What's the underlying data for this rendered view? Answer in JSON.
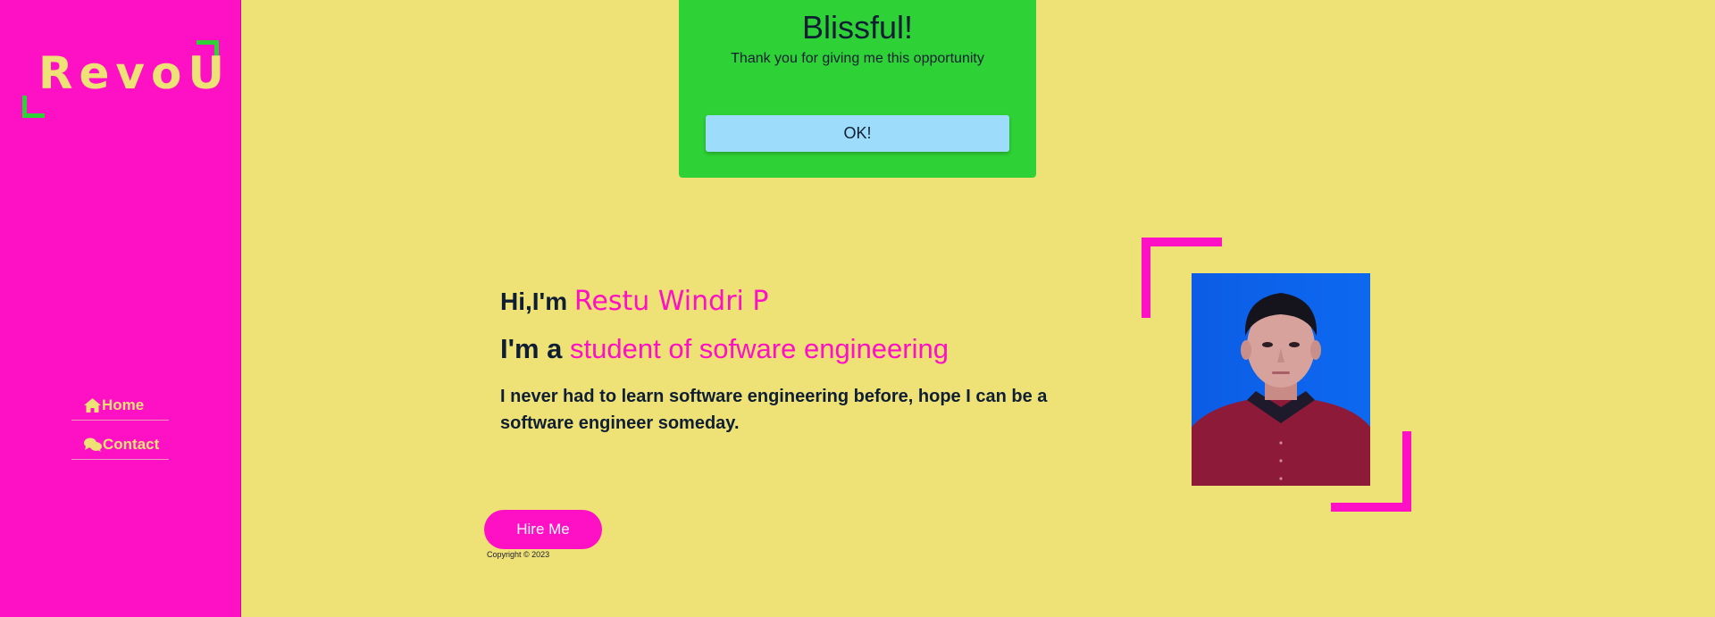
{
  "sidebar": {
    "logo": "RevoU",
    "nav": [
      {
        "label": "Home",
        "icon": "home-icon"
      },
      {
        "label": "Contact",
        "icon": "chat-bubbles-icon"
      }
    ]
  },
  "modal": {
    "title": "Blissful!",
    "message": "Thank you for giving me this opportunity",
    "ok_label": "OK!"
  },
  "hero": {
    "greeting": "Hi,I'm",
    "name": "Restu Windri P",
    "role_prefix": "I'm a",
    "role": "student of sofware engineering",
    "description": "I never had to learn software engineering before, hope I can be a software engineer someday."
  },
  "hire_label": "Hire Me",
  "copyright": "Copyright © 2023",
  "colors": {
    "background": "#eee277",
    "accent_pink": "#fe10c5",
    "accent_green": "#2fd236",
    "button_blue": "#9edcfb",
    "text_dark": "#0f1e33"
  }
}
